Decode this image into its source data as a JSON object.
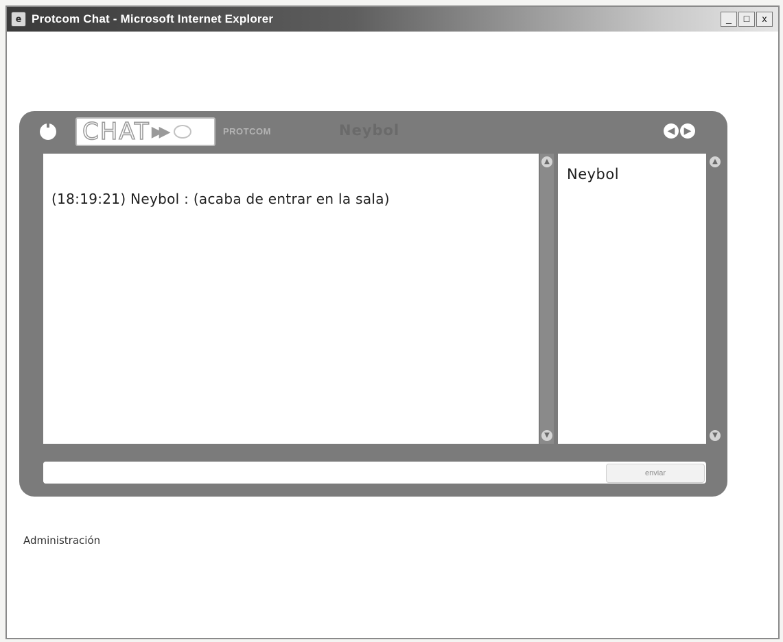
{
  "window": {
    "title": "Protcom Chat - Microsoft Internet Explorer",
    "controls": {
      "minimize": "_",
      "maximize": "□",
      "close": "x"
    }
  },
  "chat": {
    "logo_text": "CHAT",
    "brand": "PROTCOM",
    "current_user": "Neybol",
    "nav_prev": "◀",
    "nav_next": "▶",
    "messages": [
      {
        "time": "(18:19:21)",
        "text": "(18:19:21) Neybol : (acaba de entrar en la sala)"
      }
    ],
    "users": [
      "Neybol"
    ],
    "input": {
      "value": "",
      "placeholder": ""
    },
    "send_label": "enviar"
  },
  "footer": {
    "admin_link": "Administración"
  },
  "colors": {
    "frame": "#7b7b7b",
    "panel": "#ffffff",
    "title_text": "#ffffff"
  }
}
